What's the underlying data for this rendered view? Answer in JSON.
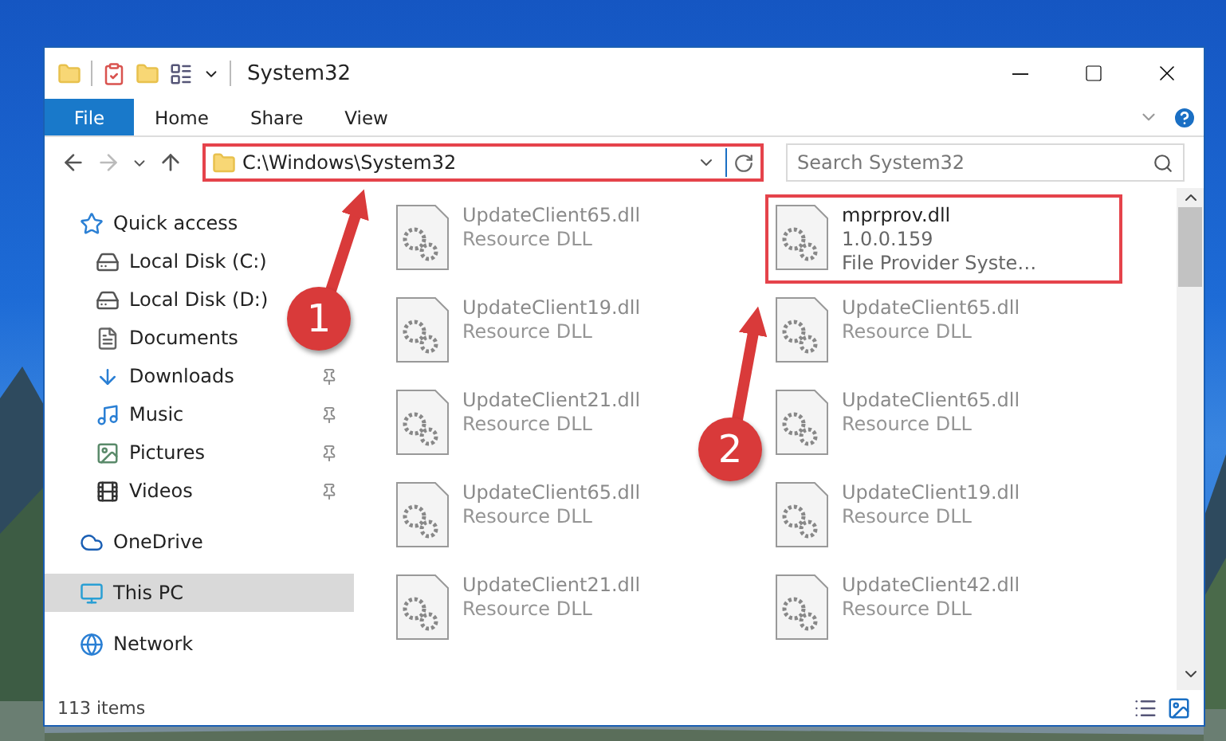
{
  "window": {
    "title": "System32"
  },
  "ribbon": {
    "tabs": [
      {
        "label": "File",
        "kind": "file"
      },
      {
        "label": "Home",
        "kind": "tab"
      },
      {
        "label": "Share",
        "kind": "tab"
      },
      {
        "label": "View",
        "kind": "tab"
      }
    ]
  },
  "address": {
    "path": "C:\\Windows\\System32",
    "highlighted": true
  },
  "search": {
    "placeholder": "Search System32"
  },
  "nav": {
    "items": [
      {
        "label": "Quick access",
        "kind": "star",
        "selected": false,
        "children": [
          {
            "label": "Local Disk (C:)",
            "kind": "drive",
            "pinned": false
          },
          {
            "label": "Local Disk (D:)",
            "kind": "drive",
            "pinned": false
          },
          {
            "label": "Documents",
            "kind": "documents",
            "pinned": false
          },
          {
            "label": "Downloads",
            "kind": "downloads",
            "pinned": true
          },
          {
            "label": "Music",
            "kind": "music",
            "pinned": true
          },
          {
            "label": "Pictures",
            "kind": "pictures",
            "pinned": true
          },
          {
            "label": "Videos",
            "kind": "videos",
            "pinned": true
          }
        ]
      },
      {
        "label": "OneDrive",
        "kind": "cloud",
        "selected": false
      },
      {
        "label": "This PC",
        "kind": "pc",
        "selected": true
      },
      {
        "label": "Network",
        "kind": "network",
        "selected": false
      }
    ]
  },
  "files": [
    {
      "name": "UpdateClient65.dll",
      "lines": [
        "Resource DLL"
      ],
      "blurred": true,
      "highlighted": false
    },
    {
      "name": "mprprov.dll",
      "lines": [
        "1.0.0.159",
        "File Provider Syste…"
      ],
      "blurred": false,
      "highlighted": true
    },
    {
      "name": "UpdateClient19.dll",
      "lines": [
        "Resource DLL"
      ],
      "blurred": true,
      "highlighted": false
    },
    {
      "name": "UpdateClient65.dll",
      "lines": [
        "Resource DLL"
      ],
      "blurred": true,
      "highlighted": false
    },
    {
      "name": "UpdateClient21.dll",
      "lines": [
        "Resource DLL"
      ],
      "blurred": true,
      "highlighted": false
    },
    {
      "name": "UpdateClient65.dll",
      "lines": [
        "Resource DLL"
      ],
      "blurred": true,
      "highlighted": false
    },
    {
      "name": "UpdateClient65.dll",
      "lines": [
        "Resource DLL"
      ],
      "blurred": true,
      "highlighted": false
    },
    {
      "name": "UpdateClient19.dll",
      "lines": [
        "Resource DLL"
      ],
      "blurred": true,
      "highlighted": false
    },
    {
      "name": "UpdateClient21.dll",
      "lines": [
        "Resource DLL"
      ],
      "blurred": true,
      "highlighted": false
    },
    {
      "name": "UpdateClient42.dll",
      "lines": [
        "Resource DLL"
      ],
      "blurred": true,
      "highlighted": false
    }
  ],
  "status_bar": {
    "count": "113 items"
  },
  "callouts": [
    {
      "number": "1"
    },
    {
      "number": "2"
    }
  ]
}
